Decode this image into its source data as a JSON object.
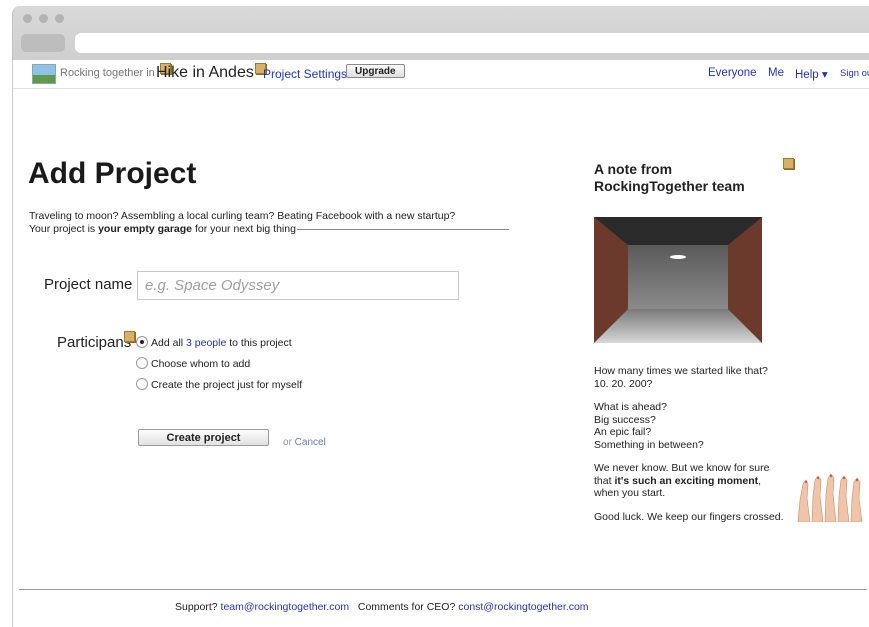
{
  "topbar": {
    "brand_text": "Rocking together in",
    "project_title": "Hike in Andes",
    "settings_label": "Project Settings",
    "upgrade_label": "Upgrade",
    "nav": {
      "everyone": "Everyone",
      "me": "Me",
      "help": "Help ▾",
      "sign_out": "Sign ou"
    }
  },
  "form": {
    "title": "Add Project",
    "intro_line1": "Traveling to moon? Assembling a local curling team? Beating Facebook with a new startup?",
    "intro_line2_prefix": "Your project is ",
    "intro_line2_bold": "your empty garage",
    "intro_line2_suffix": " for your next big thing",
    "project_name_label": "Project name",
    "project_name_placeholder": "e.g. Space Odyssey",
    "participants_label": "Participans",
    "participant_options": {
      "add_all_prefix": "Add all ",
      "add_all_link": "3 people",
      "add_all_suffix": " to this project",
      "choose": "Choose whom to add",
      "myself": "Create the project just for myself"
    },
    "selected_option": "add_all",
    "create_button": "Create project",
    "or_text": "or ",
    "cancel_link": "Cancel"
  },
  "note": {
    "title": "A note from RockingTogether team",
    "p1_line1": "How many times we started like that?",
    "p1_line2": "10. 20. 200?",
    "p2_line1": "What is ahead?",
    "p2_line2": "Big success?",
    "p2_line3": "An epic fail?",
    "p2_line4": "Something in between?",
    "p3_line1": "We never know. But we know for sure",
    "p3_line2_prefix": "that ",
    "p3_line2_bold": "it's such an exciting moment",
    "p3_line2_suffix": ",",
    "p3_line3": "when you start.",
    "p4": "Good luck. We keep our fingers crossed."
  },
  "footer": {
    "support_label": "Support? ",
    "support_email": "team@rockingtogether.com",
    "ceo_label": "Comments for CEO? ",
    "ceo_email": "const@rockingtogether.com"
  },
  "colors": {
    "link": "#2233bb",
    "text": "#222222",
    "sticky_note": "#d8b06a"
  }
}
